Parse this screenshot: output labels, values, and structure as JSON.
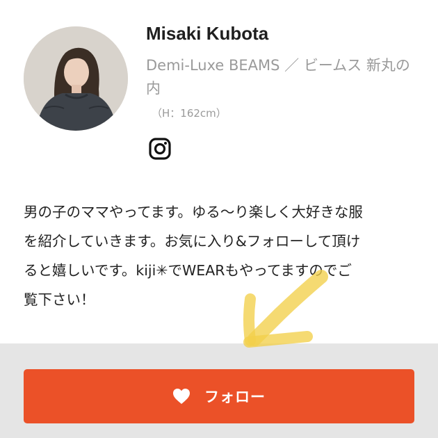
{
  "profile": {
    "name": "Misaki Kubota",
    "shop": "Demi-Luxe BEAMS ／ ビームス 新丸の内",
    "height": "（H：162cm）",
    "social_icon": "instagram-icon"
  },
  "bio": {
    "lines": [
      "男の子のママやってます。ゆる〜り楽しく大好きな服",
      "を紹介していきます。お気に入り&フォローして頂け",
      "ると嬉しいです。kiji✳︎でWEARもやってますのでご",
      "覧下さい！"
    ]
  },
  "follow": {
    "label": "フォロー",
    "icon": "heart-icon"
  },
  "colors": {
    "accent": "#eb5128",
    "bottom_bar": "#e5e5e5",
    "secondary_text": "#9a9a9a",
    "highlight": "#f2cf4a"
  }
}
